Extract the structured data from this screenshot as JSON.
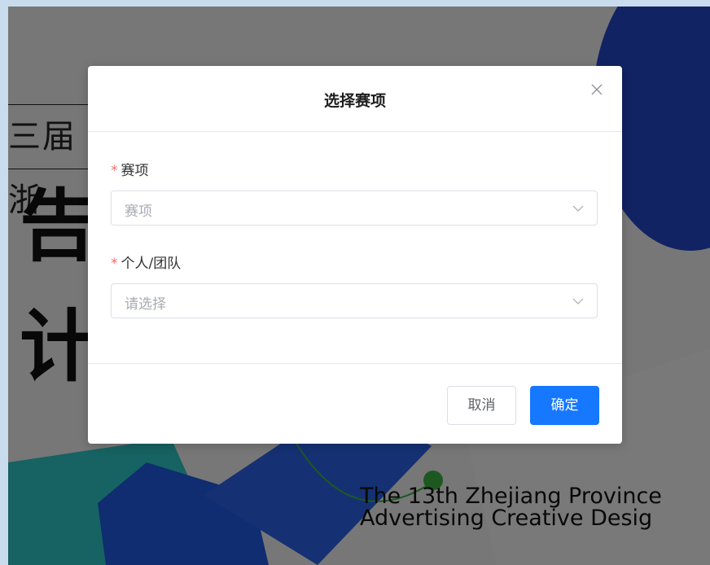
{
  "background": {
    "heading_fragment": "三届浙",
    "big_char_1": "告",
    "big_char_2": "计",
    "english_line_1": "The 13th Zhejiang Province",
    "english_line_2": "Advertising Creative Desig"
  },
  "dialog": {
    "title": "选择赛项",
    "fields": [
      {
        "label": "赛项",
        "required_mark": "*",
        "placeholder": "赛项"
      },
      {
        "label": "个人/团队",
        "required_mark": "*",
        "placeholder": "请选择"
      }
    ],
    "cancel_label": "取消",
    "confirm_label": "确定"
  },
  "colors": {
    "primary": "#1677ff",
    "required": "#f56c6c",
    "placeholder": "#a8abb2"
  }
}
